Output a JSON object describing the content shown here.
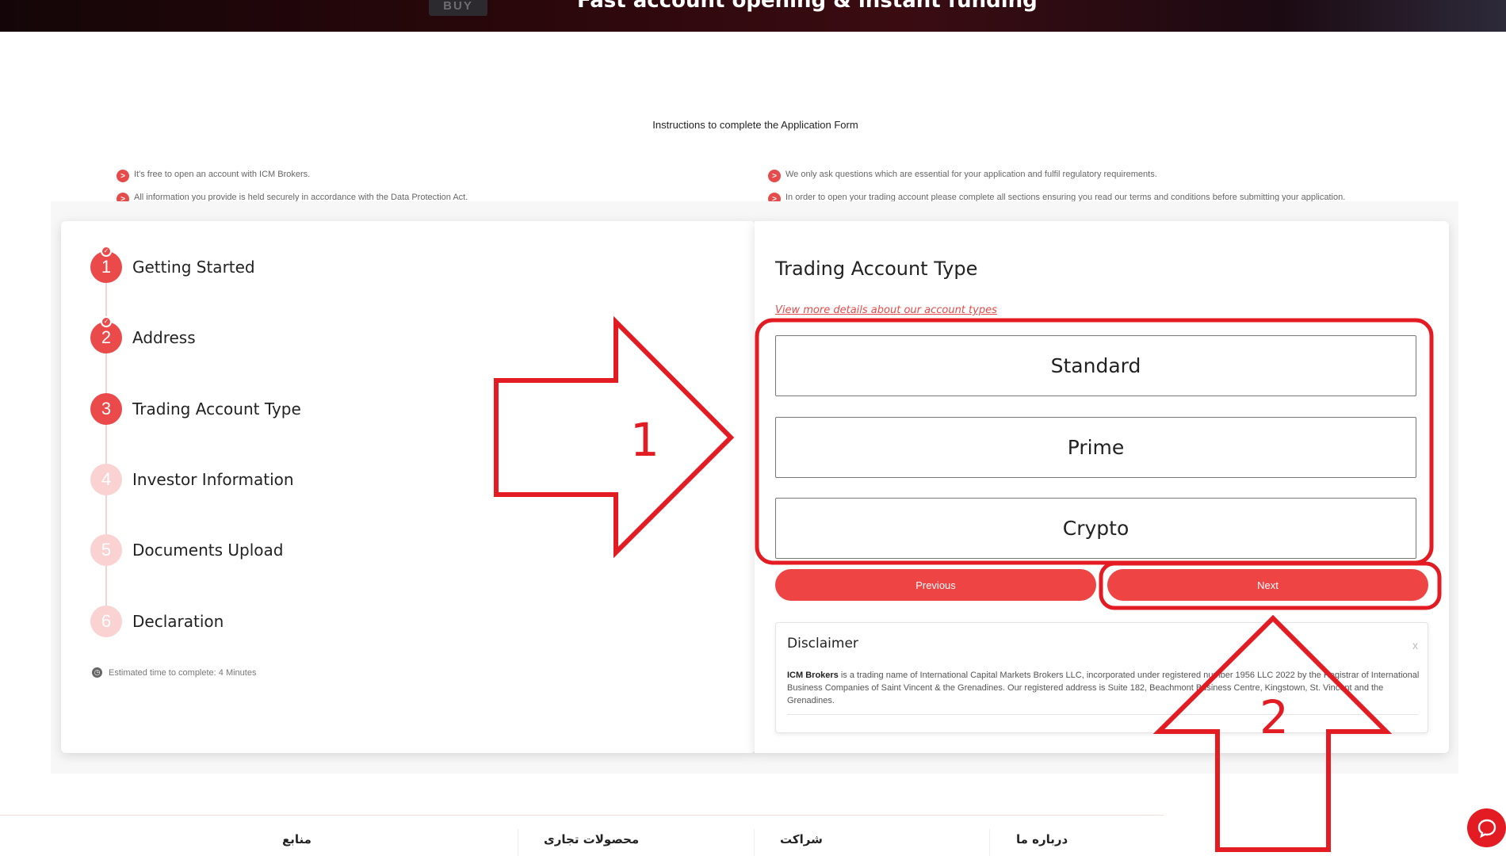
{
  "hero": {
    "buy_label": "BUY",
    "title": "Fast account opening & instant funding"
  },
  "instructions": {
    "title": "Instructions to complete the Application Form",
    "bullet_glyph": ">",
    "left": [
      "It's free to open an account with ICM Brokers.",
      "All information you provide is held securely in accordance with the Data Protection Act."
    ],
    "right": [
      "We only ask questions which are essential for your application and fulfil regulatory requirements.",
      "In order to open your trading account please complete all sections ensuring you read our terms and conditions before submitting your application."
    ]
  },
  "steps": [
    {
      "num": "1",
      "label": "Getting Started",
      "state": "done"
    },
    {
      "num": "2",
      "label": "Address",
      "state": "done"
    },
    {
      "num": "3",
      "label": "Trading Account Type",
      "state": "current"
    },
    {
      "num": "4",
      "label": "Investor Information",
      "state": "pending"
    },
    {
      "num": "5",
      "label": "Documents Upload",
      "state": "pending"
    },
    {
      "num": "6",
      "label": "Declaration",
      "state": "pending"
    }
  ],
  "estimate": "Estimated time to complete: 4 Minutes",
  "account_type": {
    "title": "Trading Account Type",
    "details_link": "View more details about our account types",
    "options": [
      "Standard",
      "Prime",
      "Crypto"
    ],
    "previous_label": "Previous",
    "next_label": "Next"
  },
  "disclaimer": {
    "title": "Disclaimer",
    "close": "x",
    "company": "ICM Brokers",
    "text": " is a trading name of International Capital Markets Brokers LLC, incorporated under registered number 1956 LLC 2022 by the Registrar of International Business Companies of Saint Vincent & the Grenadines. Our registered address is Suite 182, Beachmont Business Centre, Kingstown, St. Vincent and the Grenadines."
  },
  "annotations": {
    "arrow1_label": "1",
    "arrow2_label": "2"
  },
  "footer": {
    "items": [
      "منابع",
      "محصولات تجاری",
      "شراکت",
      "درباره ما"
    ]
  },
  "colors": {
    "accent": "#ef4444",
    "annotation": "#e31b23",
    "step_pending": "#fbd2d2"
  }
}
